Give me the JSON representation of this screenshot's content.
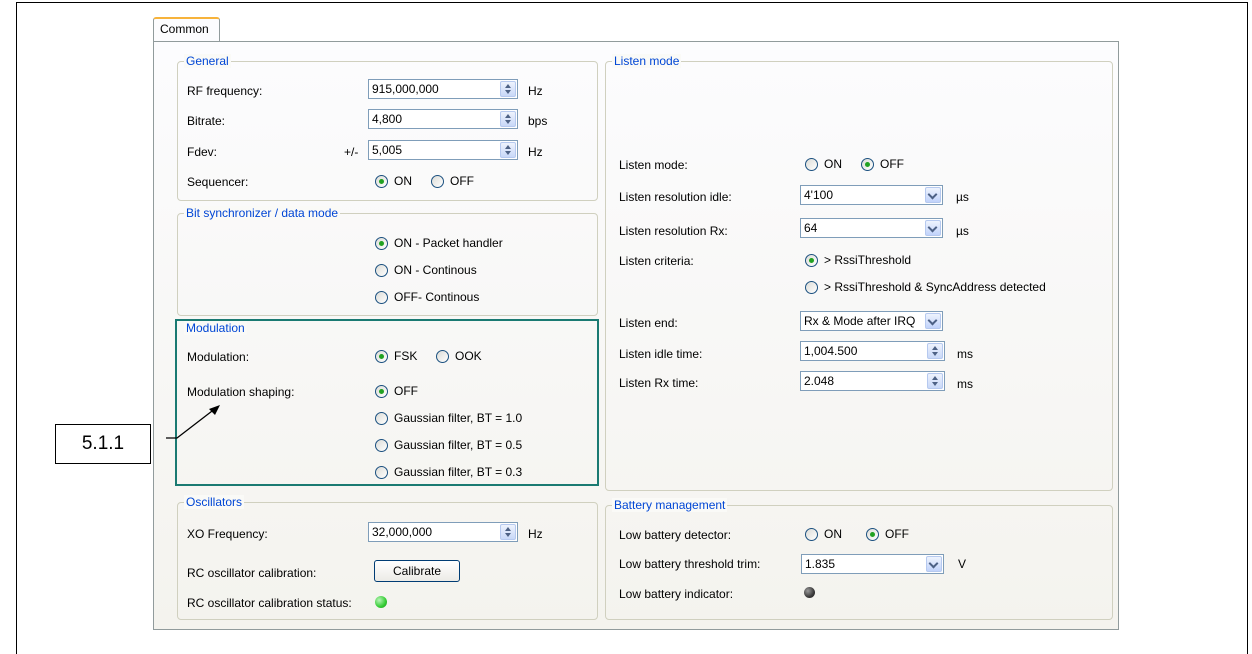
{
  "tab": {
    "label": "Common"
  },
  "colors": {
    "legend": "#0046d5",
    "highlight": "#1a7a72",
    "led_on": "#33cc33",
    "led_off": "#3a3a3a"
  },
  "general": {
    "title": "General",
    "rf_frequency": {
      "label": "RF frequency:",
      "value": "915,000,000",
      "unit": "Hz"
    },
    "bitrate": {
      "label": "Bitrate:",
      "value": "4,800",
      "unit": "bps"
    },
    "fdev": {
      "label": "Fdev:",
      "prefix": "+/-",
      "value": "5,005",
      "unit": "Hz"
    },
    "sequencer": {
      "label": "Sequencer:",
      "options": [
        "ON",
        "OFF"
      ],
      "selected": "ON"
    }
  },
  "bitsync": {
    "title": "Bit synchronizer / data mode",
    "options": [
      "ON - Packet handler",
      "ON - Continous",
      "OFF- Continous"
    ],
    "selected": "ON - Packet handler"
  },
  "modulation": {
    "title": "Modulation",
    "modulation": {
      "label": "Modulation:",
      "options": [
        "FSK",
        "OOK"
      ],
      "selected": "FSK"
    },
    "shaping": {
      "label": "Modulation shaping:",
      "options": [
        "OFF",
        "Gaussian filter, BT = 1.0",
        "Gaussian filter, BT = 0.5",
        "Gaussian filter, BT = 0.3"
      ],
      "selected": "OFF"
    }
  },
  "oscillators": {
    "title": "Oscillators",
    "xo": {
      "label": "XO Frequency:",
      "value": "32,000,000",
      "unit": "Hz"
    },
    "rc_cal": {
      "label": "RC oscillator calibration:",
      "button": "Calibrate"
    },
    "rc_status": {
      "label": "RC oscillator calibration status:"
    }
  },
  "listen": {
    "title": "Listen mode",
    "mode": {
      "label": "Listen mode:",
      "options": [
        "ON",
        "OFF"
      ],
      "selected": "OFF"
    },
    "res_idle": {
      "label": "Listen resolution idle:",
      "value": "4'100",
      "unit": "µs"
    },
    "res_rx": {
      "label": "Listen resolution Rx:",
      "value": "64",
      "unit": "µs"
    },
    "criteria": {
      "label": "Listen criteria:",
      "options": [
        "> RssiThreshold",
        "> RssiThreshold & SyncAddress detected"
      ],
      "selected": "> RssiThreshold"
    },
    "end": {
      "label": "Listen end:",
      "value": "Rx & Mode after IRQ"
    },
    "idle_time": {
      "label": "Listen idle time:",
      "value": "1,004.500",
      "unit": "ms"
    },
    "rx_time": {
      "label": "Listen Rx time:",
      "value": "2.048",
      "unit": "ms"
    }
  },
  "battery": {
    "title": "Battery management",
    "detector": {
      "label": "Low battery detector:",
      "options": [
        "ON",
        "OFF"
      ],
      "selected": "OFF"
    },
    "threshold": {
      "label": "Low battery threshold trim:",
      "value": "1.835",
      "unit": "V"
    },
    "indicator": {
      "label": "Low battery indicator:"
    }
  },
  "annotation": {
    "label": "5.1.1"
  }
}
